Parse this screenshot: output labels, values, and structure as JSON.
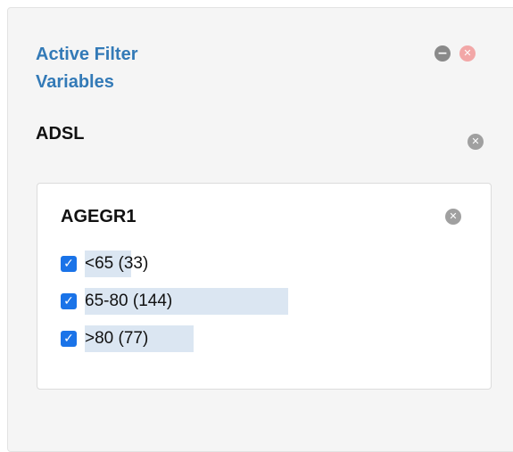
{
  "panel": {
    "title": "Active Filter Variables",
    "dataset": "ADSL"
  },
  "filter": {
    "variable": "AGEGR1",
    "options": [
      {
        "label": "<65 (33)",
        "checked": true,
        "count": 33
      },
      {
        "label": "65-80 (144)",
        "checked": true,
        "count": 144
      },
      {
        "label": ">80 (77)",
        "checked": true,
        "count": 77
      }
    ]
  },
  "icons": {
    "collapse": "minus-circle-icon",
    "remove_all": "remove-circle-icon",
    "remove_dataset": "remove-circle-icon",
    "remove_variable": "remove-circle-icon",
    "checkbox_checked": "checkmark-icon"
  },
  "colors": {
    "title": "#337ab7",
    "bar": "#dbe6f2",
    "checkbox": "#1a73e8",
    "remove_red": "#f2a7a7"
  }
}
